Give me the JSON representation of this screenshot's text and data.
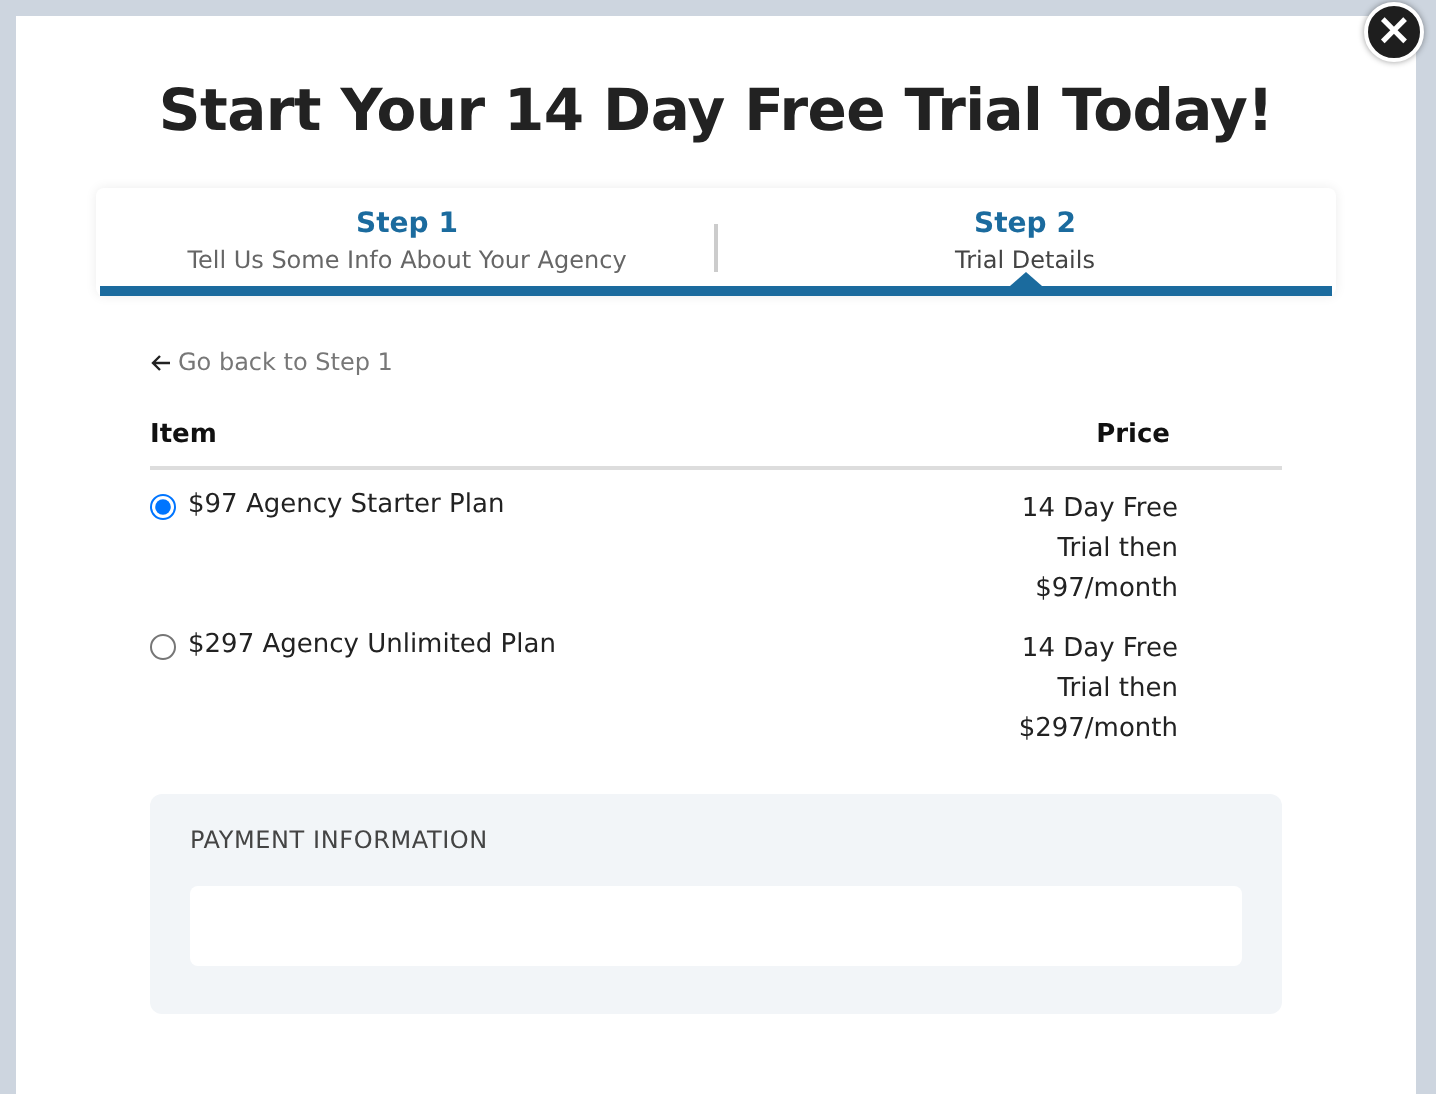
{
  "title": "Start Your 14 Day Free Trial Today!",
  "close_button": "×",
  "steps": [
    {
      "label": "Step 1",
      "caption": "Tell Us Some Info About Your Agency",
      "selected": false
    },
    {
      "label": "Step 2",
      "caption": "Trial Details",
      "selected": true
    }
  ],
  "back_link": "Go back to Step 1",
  "table": {
    "columns": [
      "Item",
      "Price"
    ],
    "rows": [
      {
        "item": "$97 Agency Starter Plan",
        "price": "14 Day Free Trial then $97/month",
        "selected": true
      },
      {
        "item": "$297 Agency Unlimited Plan",
        "price": "14 Day Free Trial then $297/month",
        "selected": false
      }
    ]
  },
  "payment": {
    "heading": "PAYMENT INFORMATION"
  }
}
